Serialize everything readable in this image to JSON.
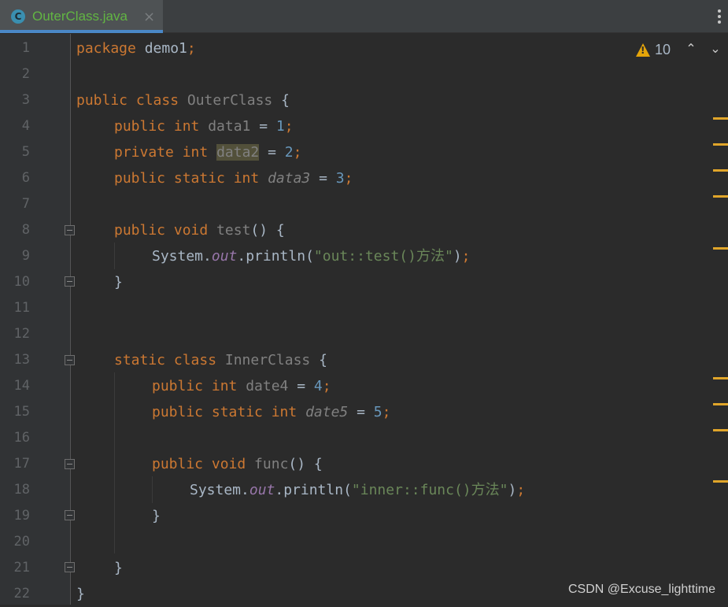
{
  "tab": {
    "title": "OuterClass.java",
    "icon_letter": "C",
    "close": "×"
  },
  "inspection": {
    "warning_count": "10",
    "up_arrow": "⌃",
    "down_arrow": "⌄"
  },
  "line_numbers": [
    "1",
    "2",
    "3",
    "4",
    "5",
    "6",
    "7",
    "8",
    "9",
    "10",
    "11",
    "12",
    "13",
    "14",
    "15",
    "16",
    "17",
    "18",
    "19",
    "20",
    "21",
    "22"
  ],
  "code": {
    "l1_kw": "package",
    "l1_rest": " demo1",
    "l1_semi": ";",
    "l3_kw": "public class",
    "l3_name": " OuterClass",
    "l3_brace": " {",
    "l4_kw": "public int",
    "l4_field": " data1",
    "l4_eq": " = ",
    "l4_num": "1",
    "l4_semi": ";",
    "l5_kw": "private int",
    "l5_field": "data2",
    "l5_eq": " = ",
    "l5_num": "2",
    "l5_semi": ";",
    "l6_kw": "public static int",
    "l6_field": "data3",
    "l6_eq": " = ",
    "l6_num": "3",
    "l6_semi": ";",
    "l8_kw": "public void",
    "l8_name": " test",
    "l8_rest": "() {",
    "l9_sys": "System.",
    "l9_out": "out",
    "l9_print": ".println(",
    "l9_str": "\"out::test()方法\"",
    "l9_end": ")",
    "l9_semi": ";",
    "l10": "}",
    "l13_kw": "static class",
    "l13_name": " InnerClass",
    "l13_brace": " {",
    "l14_kw": "public int",
    "l14_field": " date4",
    "l14_eq": " = ",
    "l14_num": "4",
    "l14_semi": ";",
    "l15_kw": "public static int",
    "l15_field": "date5",
    "l15_eq": " = ",
    "l15_num": "5",
    "l15_semi": ";",
    "l17_kw": "public void",
    "l17_name": " func",
    "l17_rest": "() {",
    "l18_sys": "System.",
    "l18_out": "out",
    "l18_print": ".println(",
    "l18_str": "\"inner::func()方法\"",
    "l18_end": ")",
    "l18_semi": ";",
    "l19": "}",
    "l21": "}",
    "l22": "}"
  },
  "watermark": "CSDN @Excuse_lighttime",
  "colors": {
    "keyword": "#cc7832",
    "string": "#6a8759",
    "number": "#6897bb",
    "static_field": "#9876aa",
    "warning": "#e5a50a",
    "tab_title": "#62b543"
  }
}
